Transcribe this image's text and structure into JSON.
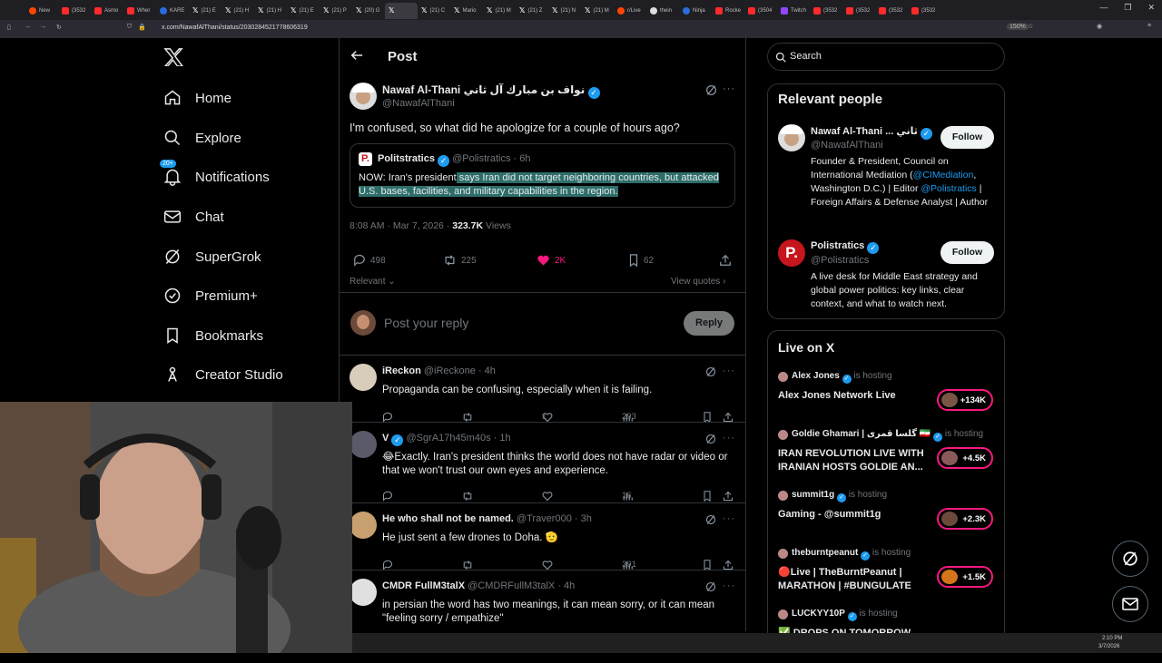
{
  "browser": {
    "tabs": [
      {
        "label": "New",
        "icon": "firefox"
      },
      {
        "label": "(3532",
        "icon": "youtube"
      },
      {
        "label": "Asmo",
        "icon": "youtube"
      },
      {
        "label": "Wher",
        "icon": "youtube"
      },
      {
        "label": "KARE",
        "icon": "blue"
      },
      {
        "label": "(21) E",
        "icon": "x"
      },
      {
        "label": "(21) H",
        "icon": "x"
      },
      {
        "label": "(21) H",
        "icon": "x"
      },
      {
        "label": "(21) E",
        "icon": "x"
      },
      {
        "label": "(21) P",
        "icon": "x"
      },
      {
        "label": "(20) G",
        "icon": "x"
      },
      {
        "label": "",
        "icon": "x"
      },
      {
        "label": "(21) C",
        "icon": "x"
      },
      {
        "label": "Mario",
        "icon": "x"
      },
      {
        "label": "(21) M",
        "icon": "x"
      },
      {
        "label": "(21) Z",
        "icon": "x"
      },
      {
        "label": "(21) N",
        "icon": "x"
      },
      {
        "label": "(21) M",
        "icon": "x"
      },
      {
        "label": "r/Live",
        "icon": "reddit"
      },
      {
        "label": "thein",
        "icon": "github"
      },
      {
        "label": "Ninja",
        "icon": "blue"
      },
      {
        "label": "Rocke",
        "icon": "youtube"
      },
      {
        "label": "(3504",
        "icon": "youtube"
      },
      {
        "label": "Twitch",
        "icon": "twitch"
      },
      {
        "label": "(3532",
        "icon": "youtube"
      },
      {
        "label": "(3532",
        "icon": "youtube"
      },
      {
        "label": "(3532",
        "icon": "youtube"
      },
      {
        "label": "(3532",
        "icon": "youtube"
      }
    ],
    "url": "x.com/NawafAlThani/status/2030284521778606319",
    "zoom": "150%"
  },
  "nav": {
    "items": [
      {
        "label": "Home",
        "icon": "home-icon"
      },
      {
        "label": "Explore",
        "icon": "search-icon"
      },
      {
        "label": "Notifications",
        "icon": "bell-icon",
        "badge": "20+"
      },
      {
        "label": "Chat",
        "icon": "mail-icon"
      },
      {
        "label": "SuperGrok",
        "icon": "grok-icon"
      },
      {
        "label": "Premium+",
        "icon": "verified-icon"
      },
      {
        "label": "Bookmarks",
        "icon": "bookmark-icon"
      },
      {
        "label": "Creator Studio",
        "icon": "creator-icon"
      }
    ]
  },
  "post": {
    "header_title": "Post",
    "author_name": "Nawaf Al-Thani نواف بن مبارك آل ثاني",
    "author_handle": "@NawafAlThani",
    "text": "I'm confused, so what did he apologize for a couple of hours ago?",
    "quote": {
      "name": "Politstratics",
      "handle": "@Polistratics",
      "time": "· 6h",
      "text_plain": "NOW: Iran's president",
      "text_highlight": " says Iran did not target neighboring countries, but attacked U.S. bases, facilities, and military capabilities in the region."
    },
    "timestamp": "8:08 AM · Mar 7, 2026 ·",
    "views_count": "323.7K",
    "views_label": "Views",
    "replies": "498",
    "reposts": "225",
    "likes": "2K",
    "bookmarks": "62",
    "sort_label": "Relevant",
    "view_quotes": "View quotes",
    "reply_placeholder": "Post your reply",
    "reply_button": "Reply"
  },
  "replies": [
    {
      "name": "iReckon",
      "handle": "@iReckone",
      "time": "· 4h",
      "text": "Propaganda can be confusing, especially when it is failing.",
      "likes": "1",
      "views": "293"
    },
    {
      "name": "V",
      "handle": "@SgrA17h45m40s",
      "time": "· 1h",
      "text": "😂Exactly.  Iran's president thinks the world does not have radar or video or that we won't trust our own eyes and experience.",
      "likes": "",
      "views": "16"
    },
    {
      "name": "He who shall not be named.",
      "handle": "@Traver000",
      "time": "· 3h",
      "text": "He just sent a few drones to Doha. 🫡",
      "likes": "",
      "views": "391"
    },
    {
      "name": "CMDR FullM3talX",
      "handle": "@CMDRFullM3talX",
      "time": "· 4h",
      "text": "in persian the word has two meanings, it can mean sorry, or it can mean \"feeling sorry / empathize\"",
      "likes": "",
      "views": ""
    }
  ],
  "sidebar": {
    "search_placeholder": "Search",
    "relevant_title": "Relevant people",
    "people": [
      {
        "name": "Nawaf Al-Thani ... ثاني",
        "handle": "@NawafAlThani",
        "follow": "Follow",
        "bio_1": "Founder & President, Council on International Mediation (",
        "bio_link1": "@CIMediation",
        "bio_2": ", Washington D.C.) | Editor ",
        "bio_link2": "@Polistratics",
        "bio_3": " | Foreign Affairs & Defense Analyst | Author"
      },
      {
        "name": "Polistratics",
        "handle": "@Polistratics",
        "follow": "Follow",
        "bio": "A live desk for Middle East strategy and global power politics: key links, clear context, and what to watch next."
      }
    ],
    "live_title": "Live on X",
    "hosting_label": "is hosting",
    "live": [
      {
        "host": "Alex Jones",
        "title": "Alex Jones Network Live",
        "count": "+134K"
      },
      {
        "host": "Goldie Ghamari | گلسا قمری 🇮🇷",
        "title": "IRAN REVOLUTION LIVE WITH IRANIAN HOSTS GOLDIE AN...",
        "count": "+4.5K"
      },
      {
        "host": "summit1g",
        "title": "Gaming - @summit1g",
        "count": "+2.3K"
      },
      {
        "host": "theburntpeanut",
        "title": "🔴Live | TheBurntPeanut | MARATHON | #BUNGULATE",
        "count": "+1.5K"
      },
      {
        "host": "LUCKYY10P",
        "title": "✅ DROPS ON TOMORROW",
        "count": ""
      }
    ]
  },
  "taskbar": {
    "time": "2:10 PM",
    "date": "3/7/2026"
  }
}
